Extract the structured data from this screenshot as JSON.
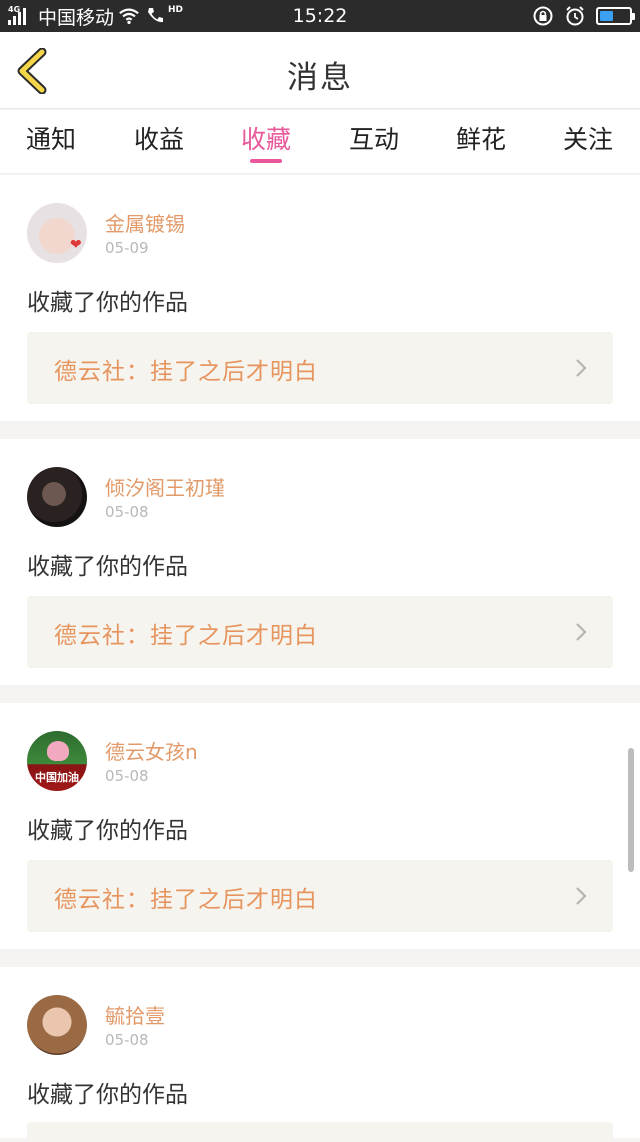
{
  "status_bar": {
    "network_label": "4G",
    "carrier": "中国移动",
    "hd_label": "HD",
    "time": "15:22",
    "battery_level": 0.45,
    "icons": [
      "signal-icon",
      "wifi-icon",
      "phone-icon",
      "rotation-lock-icon",
      "alarm-icon",
      "battery-icon"
    ]
  },
  "nav": {
    "title": "消息",
    "back_icon": "chevron-left-icon"
  },
  "tabs": [
    {
      "label": "通知",
      "active": false
    },
    {
      "label": "收益",
      "active": false
    },
    {
      "label": "收藏",
      "active": true
    },
    {
      "label": "互动",
      "active": false
    },
    {
      "label": "鲜花",
      "active": false
    },
    {
      "label": "关注",
      "active": false
    }
  ],
  "items": [
    {
      "name": "金属镀锡",
      "date": "05-09",
      "action": "收藏了你的作品",
      "work": "德云社：挂了之后才明白"
    },
    {
      "name": "倾汐阁王初瑾",
      "date": "05-08",
      "action": "收藏了你的作品",
      "work": "德云社：挂了之后才明白"
    },
    {
      "name": "德云女孩n",
      "date": "05-08",
      "action": "收藏了你的作品",
      "work": "德云社：挂了之后才明白",
      "avatar_text": "中国加油"
    },
    {
      "name": "毓拾壹",
      "date": "05-08",
      "action": "收藏了你的作品",
      "work": ""
    }
  ],
  "colors": {
    "accent": "#e8589a",
    "name": "#e29a6a",
    "work": "#e7955f",
    "back": "#f5d64a"
  }
}
